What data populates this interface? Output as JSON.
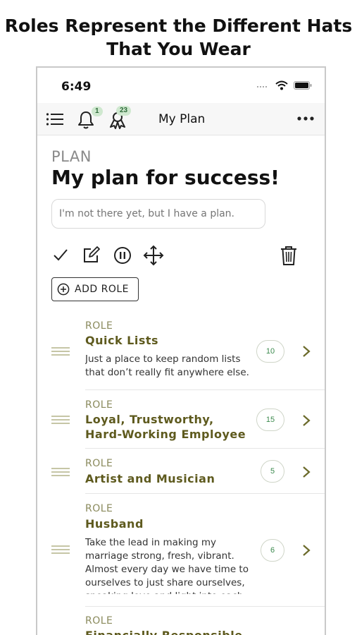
{
  "caption": {
    "line1": "Roles Represent the Different Hats",
    "line2": "That You Wear"
  },
  "status_bar": {
    "time": "6:49"
  },
  "navbar": {
    "title": "My Plan",
    "notifications_badge": "1",
    "achievements_badge": "23"
  },
  "plan": {
    "label": "PLAN",
    "title": "My plan for success!",
    "note_placeholder": "I'm not there yet, but I have a plan."
  },
  "toolbar": {
    "add_role_label": "ADD ROLE"
  },
  "roles": [
    {
      "kicker": "ROLE",
      "name": "Quick Lists",
      "description": "Just a place to keep random lists that don’t really fit anywhere else.",
      "count": "10"
    },
    {
      "kicker": "ROLE",
      "name": "Loyal, Trustworthy, Hard-Working Employee",
      "description": "",
      "count": "15"
    },
    {
      "kicker": "ROLE",
      "name": "Artist and Musician",
      "description": "",
      "count": "5"
    },
    {
      "kicker": "ROLE",
      "name": "Husband",
      "description": "Take the lead in making my marriage strong, fresh, vibrant. Almost every day we have time to ourselves to just share ourselves, speaking love and light into each",
      "count": "6"
    },
    {
      "kicker": "ROLE",
      "name": "Financially Responsible",
      "description": "",
      "count": ""
    }
  ],
  "colors": {
    "role_title": "#5e5a1e",
    "role_kicker": "#8a8a5c",
    "count_text": "#3c8a4e",
    "badge_bg": "#cfe8cf"
  }
}
